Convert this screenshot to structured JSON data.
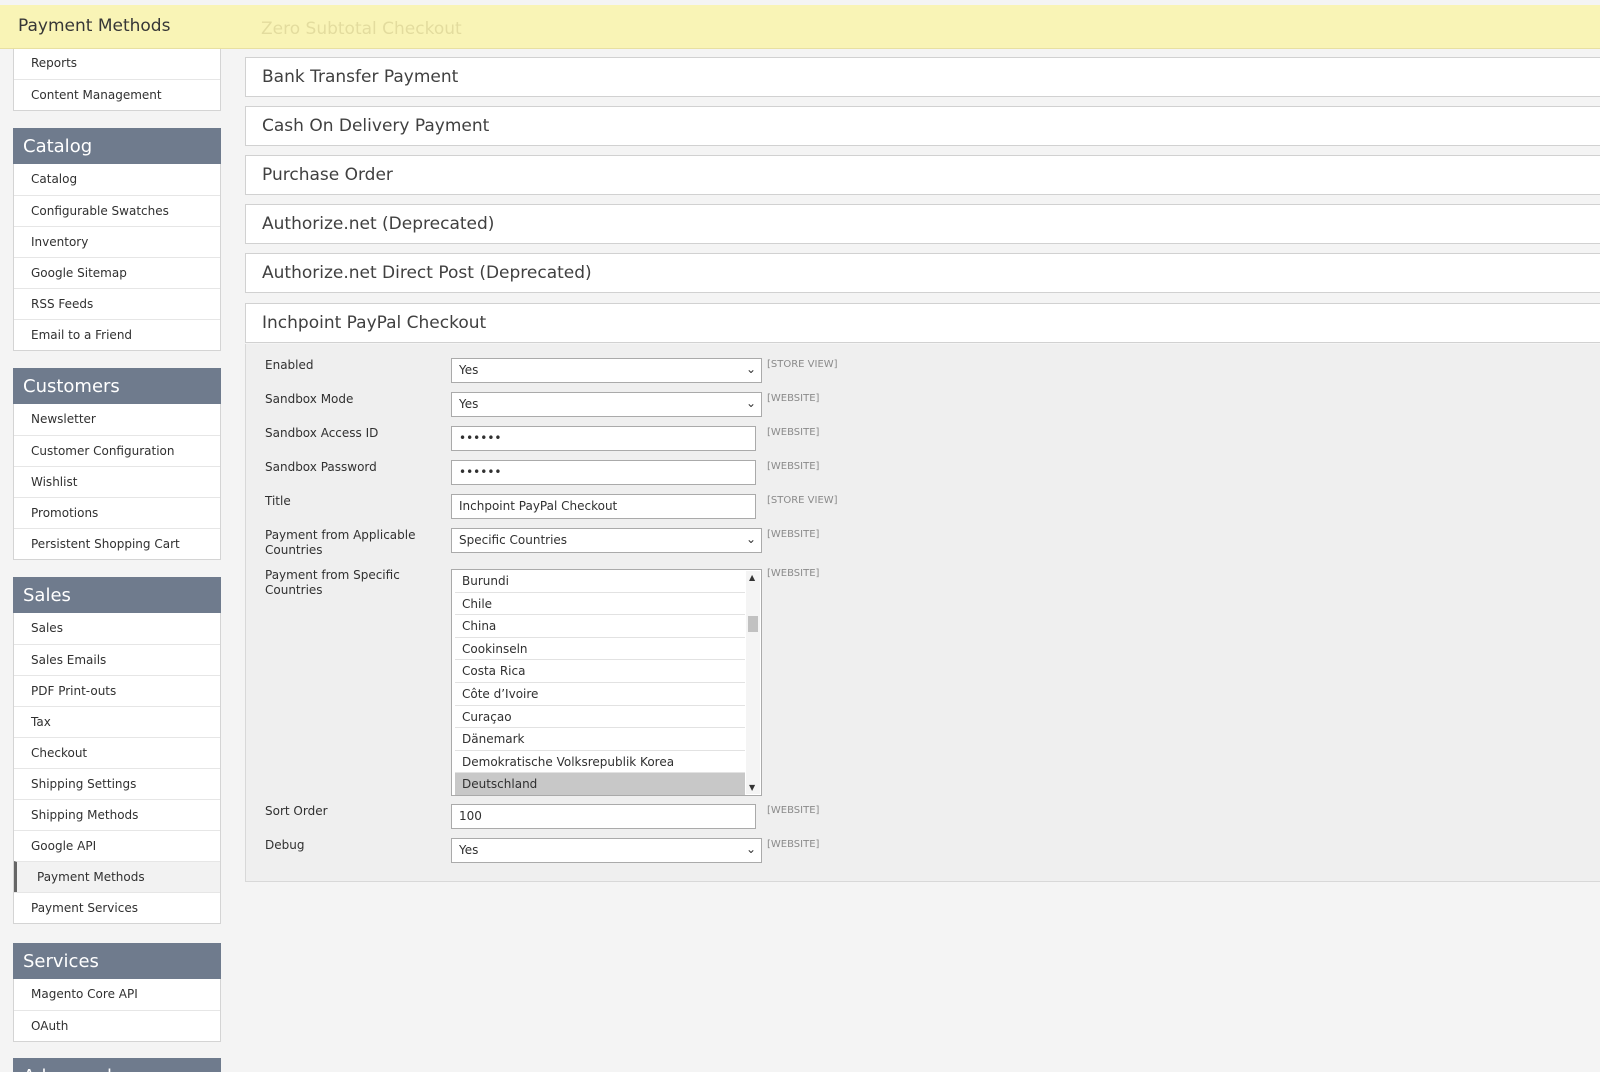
{
  "header": {
    "title": "Payment Methods",
    "ghost_section": "Zero Subtotal Checkout"
  },
  "sidebar": {
    "top_items": [
      "Reports",
      "Content Management"
    ],
    "groups": [
      {
        "title": "Catalog",
        "items": [
          "Catalog",
          "Configurable Swatches",
          "Inventory",
          "Google Sitemap",
          "RSS Feeds",
          "Email to a Friend"
        ]
      },
      {
        "title": "Customers",
        "items": [
          "Newsletter",
          "Customer Configuration",
          "Wishlist",
          "Promotions",
          "Persistent Shopping Cart"
        ]
      },
      {
        "title": "Sales",
        "items": [
          "Sales",
          "Sales Emails",
          "PDF Print-outs",
          "Tax",
          "Checkout",
          "Shipping Settings",
          "Shipping Methods",
          "Google API",
          "Payment Methods",
          "Payment Services"
        ],
        "active": "Payment Methods"
      },
      {
        "title": "Services",
        "items": [
          "Magento Core API",
          "OAuth"
        ]
      },
      {
        "title": "Advanced",
        "items": []
      }
    ]
  },
  "sections": [
    "Bank Transfer Payment",
    "Cash On Delivery Payment",
    "Purchase Order",
    "Authorize.net (Deprecated)",
    "Authorize.net Direct Post (Deprecated)",
    "Inchpoint PayPal Checkout"
  ],
  "config": {
    "enabled": {
      "label": "Enabled",
      "value": "Yes",
      "scope": "[STORE VIEW]"
    },
    "sandbox_mode": {
      "label": "Sandbox Mode",
      "value": "Yes",
      "scope": "[WEBSITE]"
    },
    "sandbox_access_id": {
      "label": "Sandbox Access ID",
      "value": "••••••",
      "scope": "[WEBSITE]"
    },
    "sandbox_password": {
      "label": "Sandbox Password",
      "value": "••••••",
      "scope": "[WEBSITE]"
    },
    "title": {
      "label": "Title",
      "value": "Inchpoint PayPal Checkout",
      "scope": "[STORE VIEW]"
    },
    "applicable_countries": {
      "label": "Payment from Applicable Countries",
      "value": "Specific Countries",
      "scope": "[WEBSITE]"
    },
    "specific_countries": {
      "label": "Payment from Specific Countries",
      "scope": "[WEBSITE]",
      "options": [
        "Burundi",
        "Chile",
        "China",
        "Cookinseln",
        "Costa Rica",
        "Côte d’Ivoire",
        "Curaçao",
        "Dänemark",
        "Demokratische Volksrepublik Korea",
        "Deutschland"
      ],
      "selected": "Deutschland"
    },
    "sort_order": {
      "label": "Sort Order",
      "value": "100",
      "scope": "[WEBSITE]"
    },
    "debug": {
      "label": "Debug",
      "value": "Yes",
      "scope": "[WEBSITE]"
    }
  }
}
